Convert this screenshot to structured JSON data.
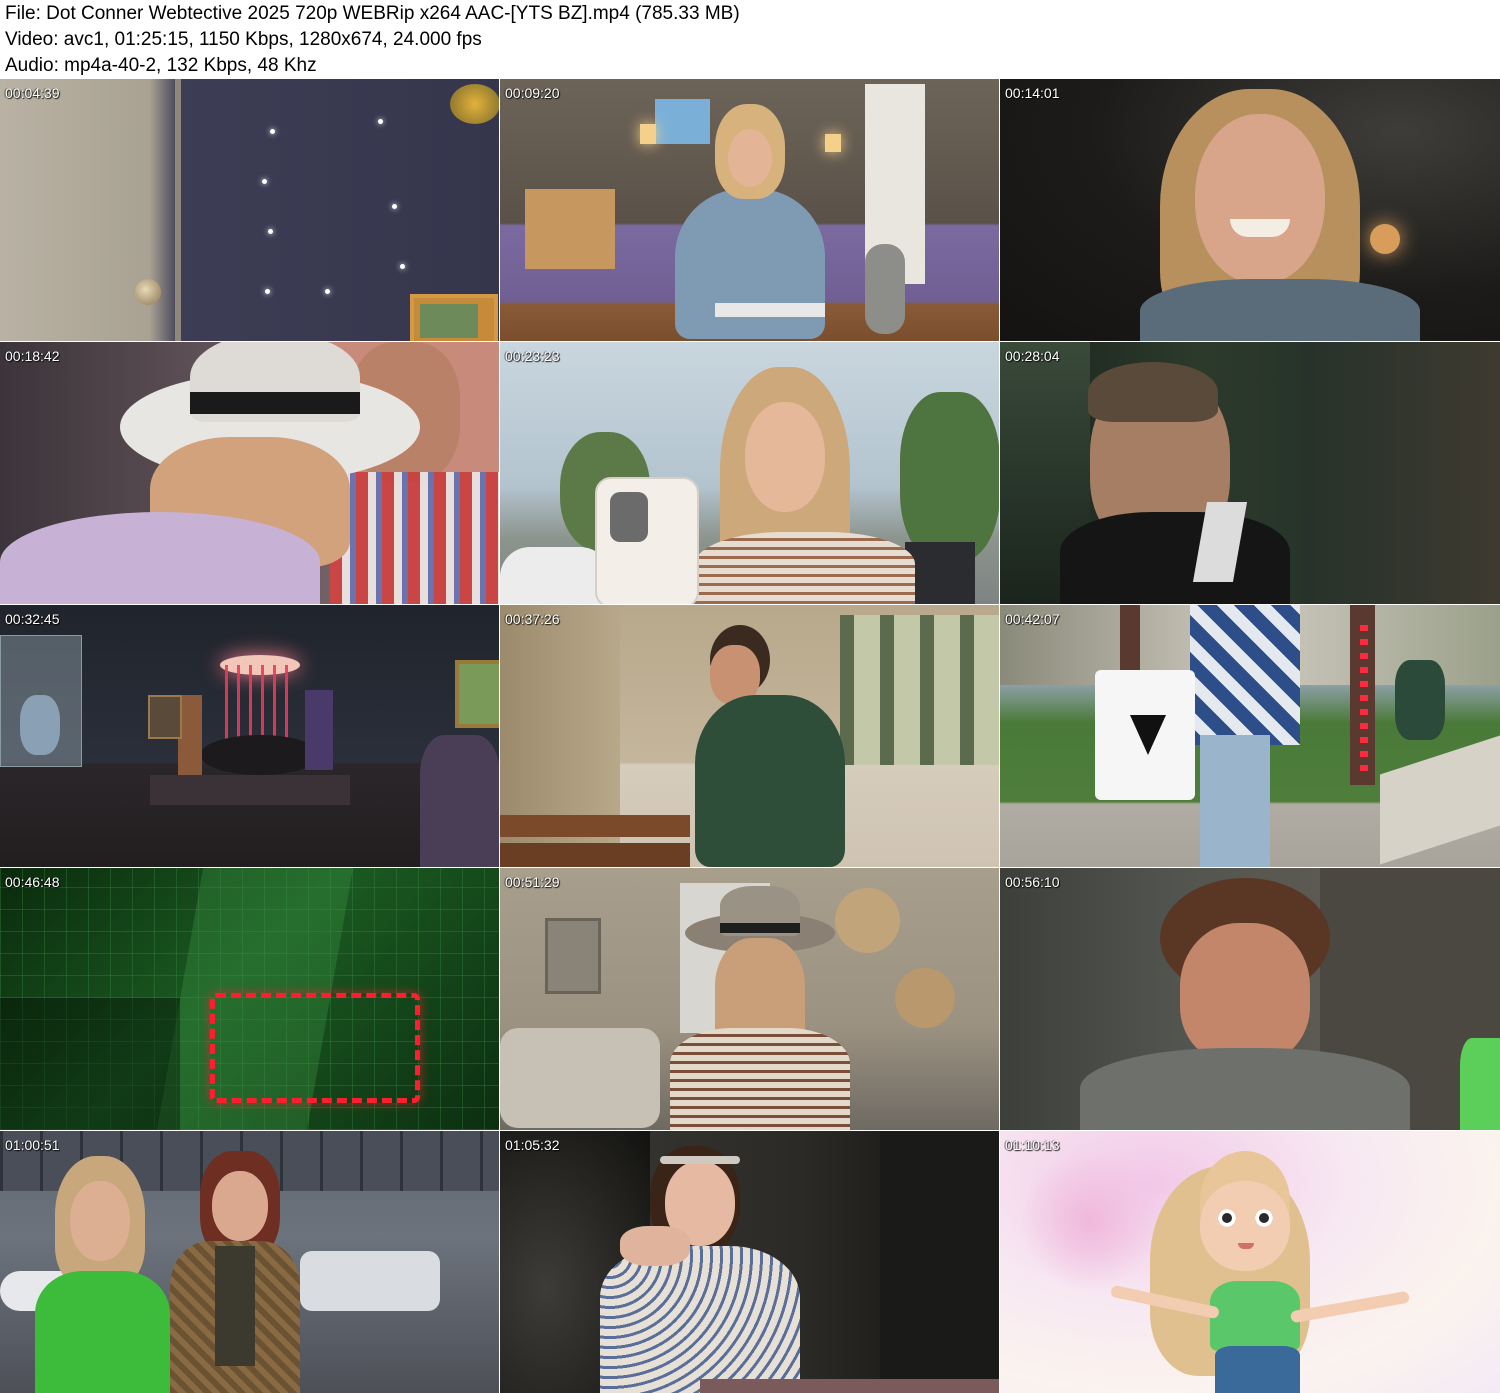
{
  "header": {
    "file_line": "File: Dot Conner Webtective 2025 720p WEBRip x264 AAC-[YTS BZ].mp4 (785.33 MB)",
    "video_line": "Video: avc1, 01:25:15, 1150 Kbps, 1280x674, 24.000 fps",
    "audio_line": "Audio: mp4a-40-2, 132 Kbps, 48 Khz"
  },
  "thumbnails": [
    {
      "timestamp": "00:04:39",
      "palette": {
        "bg": "#3a3a52",
        "accent": "#c9c2b4"
      }
    },
    {
      "timestamp": "00:09:20",
      "palette": {
        "bg": "#5b4e45",
        "accent": "#8f86b8"
      }
    },
    {
      "timestamp": "00:14:01",
      "palette": {
        "bg": "#1c1c1a",
        "accent": "#c79a7a"
      }
    },
    {
      "timestamp": "00:18:42",
      "palette": {
        "bg": "#6a5c5a",
        "accent": "#e3e0dc"
      }
    },
    {
      "timestamp": "00:23:23",
      "palette": {
        "bg": "#a7b6c0",
        "accent": "#d6b48c"
      }
    },
    {
      "timestamp": "00:28:04",
      "palette": {
        "bg": "#1d2a22",
        "accent": "#9b7a62"
      }
    },
    {
      "timestamp": "00:32:45",
      "palette": {
        "bg": "#262a34",
        "accent": "#d85060"
      }
    },
    {
      "timestamp": "00:37:26",
      "palette": {
        "bg": "#b8a88e",
        "accent": "#3c5a44"
      }
    },
    {
      "timestamp": "00:42:07",
      "palette": {
        "bg": "#4e7a3a",
        "accent": "#d9d9d9"
      }
    },
    {
      "timestamp": "00:46:48",
      "palette": {
        "bg": "#0f3a12",
        "accent": "#ff2030"
      }
    },
    {
      "timestamp": "00:51:29",
      "palette": {
        "bg": "#9c9282",
        "accent": "#6b5a48"
      }
    },
    {
      "timestamp": "00:56:10",
      "palette": {
        "bg": "#4c4f4a",
        "accent": "#b07e62"
      }
    },
    {
      "timestamp": "01:00:51",
      "palette": {
        "bg": "#5a6270",
        "accent": "#3fbf3f"
      }
    },
    {
      "timestamp": "01:05:32",
      "palette": {
        "bg": "#2a2a28",
        "accent": "#d8cfc4"
      }
    },
    {
      "timestamp": "01:10:13",
      "palette": {
        "bg": "#f3e2f0",
        "accent": "#55c065"
      }
    }
  ]
}
